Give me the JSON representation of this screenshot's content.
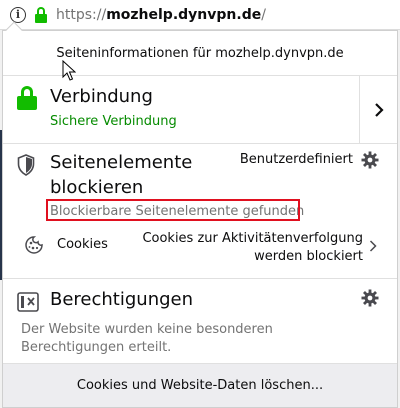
{
  "urlbar": {
    "url_prefix": "https://",
    "url_domain": "mozhelp.dynvpn.de",
    "url_suffix": "/"
  },
  "panel": {
    "header": "Seiteninformationen für mozhelp.dynvpn.de",
    "connection": {
      "title": "Verbindung",
      "status": "Sichere Verbindung"
    },
    "blocking": {
      "title": "Seitenelemente blockieren",
      "mode": "Benutzerdefiniert",
      "found": "Blockierbare Seitenelemente gefunden",
      "cookies_label": "Cookies",
      "cookies_status": "Cookies zur Aktivitätenverfolgung werden blockiert"
    },
    "permissions": {
      "title": "Berechtigungen",
      "text": "Der Website wurden keine besonderen Berechtigungen erteilt."
    },
    "footer_button": "Cookies und Website-Daten löschen..."
  },
  "colors": {
    "secure_green": "#12bc00",
    "secure_text": "#058b00",
    "highlight_red": "#e0101f"
  }
}
